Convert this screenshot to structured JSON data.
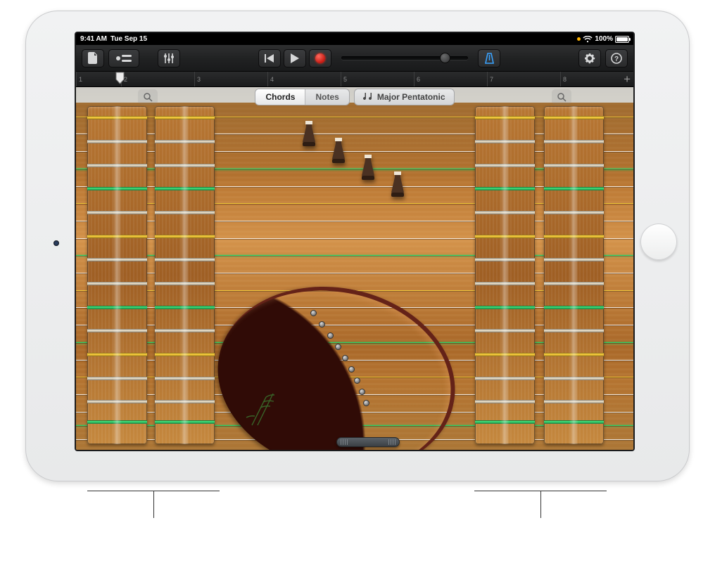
{
  "status": {
    "time": "9:41 AM",
    "date": "Tue Sep 15",
    "battery_pct": "100%"
  },
  "ruler": {
    "bars": [
      "1",
      "2",
      "3",
      "4",
      "5",
      "6",
      "7",
      "8"
    ]
  },
  "mode": {
    "chords": "Chords",
    "notes": "Notes"
  },
  "scale": {
    "label": "Major Pentatonic"
  },
  "icons": {
    "my_songs": "document-icon",
    "browser": "sounds-browser-icon",
    "mixer": "mixer-icon",
    "prev": "previous-icon",
    "play": "play-icon",
    "record": "record-icon",
    "metronome": "metronome-icon",
    "settings": "gear-icon",
    "help": "help-icon",
    "add_section": "plus-icon",
    "zoom": "magnifier-icon",
    "scale_glyph": "note-pair-icon"
  },
  "colors": {
    "accent_blue": "#3aa3ff",
    "record_red": "#e0281c",
    "string_green": "#2cd56b",
    "string_yellow": "#f5c938",
    "wood": "#b77430"
  }
}
